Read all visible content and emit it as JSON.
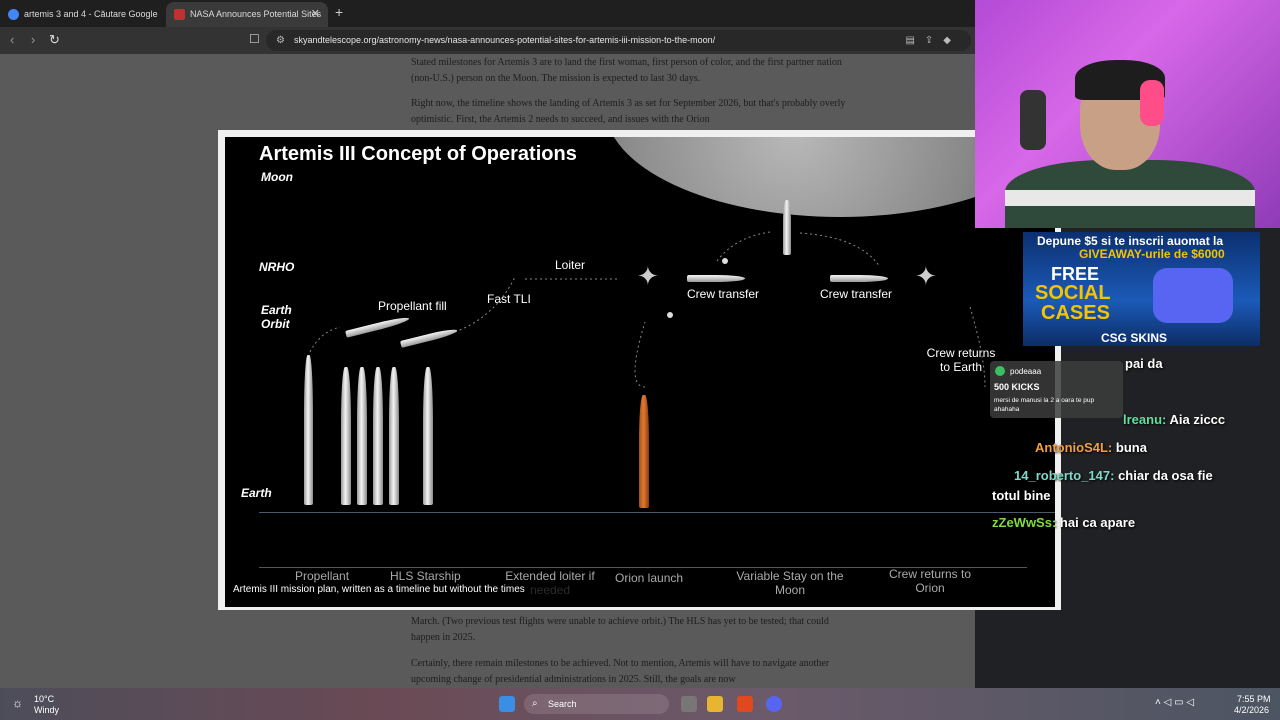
{
  "tabs": [
    {
      "title": "artemis 3 and 4 - Căutare Google"
    },
    {
      "title": "NASA Announces Potential Sites"
    }
  ],
  "new_tab": "+",
  "address": {
    "url": "skyandtelescope.org/astronomy-news/nasa-announces-potential-sites-for-artemis-iii-mission-to-the-moon/"
  },
  "article": {
    "p1": "Stated milestones for Artemis 3 are to land the first woman, first person of color, and the first partner nation (non-U.S.) person on the Moon. The mission is expected to last 30 days.",
    "p2": "Right now, the timeline shows the landing of Artemis 3 as set for September 2026, but that's probably overly optimistic. First, the Artemis 2 needs to succeed, and issues with the Orion",
    "p3": "March. (Two previous test flights were unable to achieve orbit.) The HLS has yet to be tested; that could happen in 2025.",
    "p4": "Certainly, there remain milestones to be achieved. Not to mention, Artemis will have to navigate another upcoming change of presidential administrations in 2025. Still, the goals are now"
  },
  "slide": {
    "title": "Artemis III Concept of Operations",
    "levels": {
      "moon": "Moon",
      "nrho": "NRHO",
      "earth_orbit": "Earth Orbit",
      "earth": "Earth"
    },
    "labels": {
      "propellant_fill": "Propellant fill",
      "fast_tli": "Fast TLI",
      "loiter": "Loiter",
      "crew_transfer_1": "Crew transfer",
      "crew_transfer_2": "Crew transfer",
      "crew_returns": "Crew returns to Earth"
    },
    "phases": [
      "Propellant",
      "HLS Starship",
      "Extended loiter if needed",
      "Orion launch",
      "Variable Stay on the Moon",
      "Crew returns to Orion"
    ]
  },
  "caption": "Artemis III mission plan, written as a timeline but without the times",
  "ad": {
    "line1": "Depune $5 si te inscrii auomat la",
    "line2": "GIVEAWAY-urile de $6000",
    "free": "FREE",
    "social": "SOCIAL",
    "cases": "CASES",
    "brand": "CSG SKINS",
    "accent": "#f5c400"
  },
  "popup": {
    "user": "podeaaa",
    "kicks": "500 KICKS",
    "msg": "mersi de manusi la 2 a oara te pup ahahaha"
  },
  "chat": [
    {
      "user": "",
      "text": "pai da",
      "color": "#ffffff"
    },
    {
      "user": "lreanu:",
      "text": "Aia ziccc",
      "color": "#5fe0a0"
    },
    {
      "user": "AntonioS4L:",
      "text": "buna",
      "color": "#f0a040"
    },
    {
      "user": "14_roberto_147:",
      "text": "chiar da osa fie",
      "color": "#7fd8c8"
    },
    {
      "user": "",
      "text": "totul bine",
      "color": "#ffffff"
    },
    {
      "user": "zZeWwSs:",
      "text": "hai ca apare",
      "color": "#7fdc3c"
    }
  ],
  "taskbar": {
    "temp": "10°C",
    "weather": "Windy",
    "search": "Search",
    "time": "7:55 PM",
    "date": "4/2/2026"
  },
  "icons": [
    "google-icon",
    "artemis-tab-icon",
    "back-icon",
    "forward-icon",
    "reload-icon",
    "bookmark-icon",
    "windows-icon",
    "search-icon"
  ]
}
